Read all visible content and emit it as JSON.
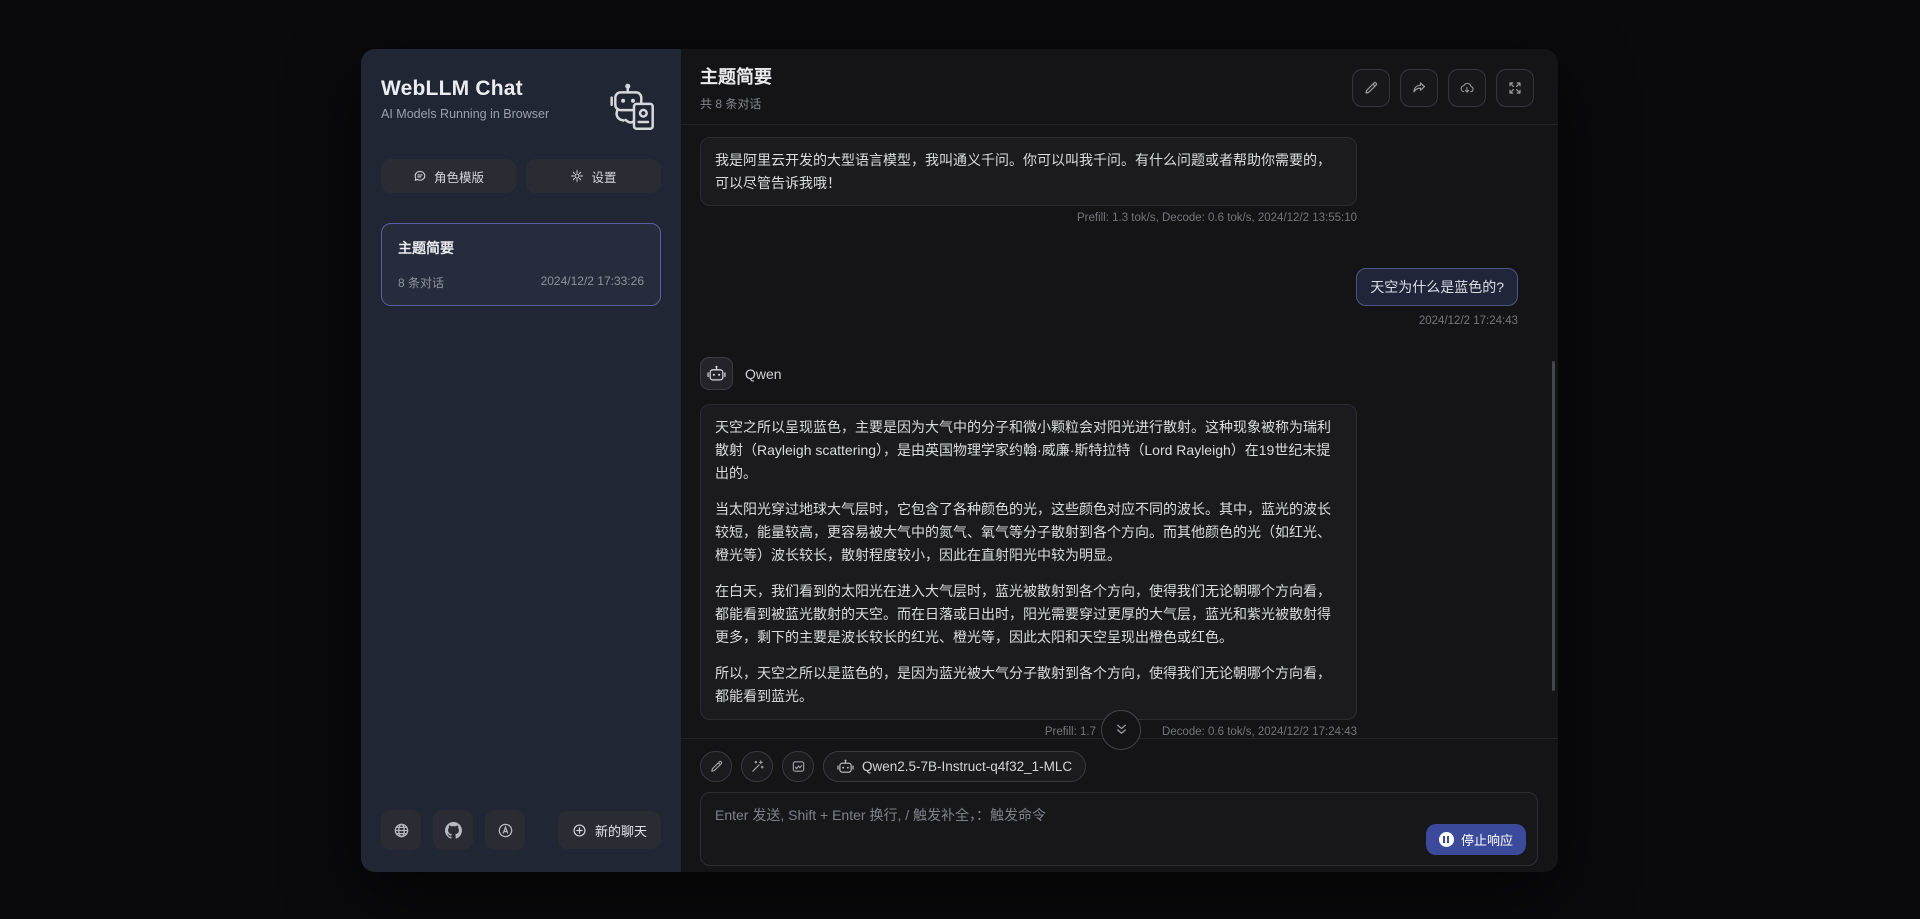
{
  "colors": {
    "accent_button": "#3b4a9a",
    "selected_chat_border": "#5a5fa0",
    "user_bubble_border": "#4d5680",
    "sidebar_bg": "#212634",
    "main_bg": "#141416"
  },
  "sidebar": {
    "title": "WebLLM Chat",
    "subtitle": "AI Models Running in Browser",
    "templates_button": "角色模版",
    "settings_button": "设置",
    "chat_item": {
      "title": "主题简要",
      "count": "8 条对话",
      "time": "2024/12/2 17:33:26"
    },
    "new_chat_button": "新的聊天"
  },
  "header": {
    "title": "主题简要",
    "subtitle": "共 8 条对话"
  },
  "chat": {
    "assistant_intro": {
      "text": "我是阿里云开发的大型语言模型，我叫通义千问。你可以叫我千问。有什么问题或者帮助你需要的，可以尽管告诉我哦！",
      "stats": "Prefill: 1.3 tok/s,  Decode: 0.6 tok/s,  2024/12/2 13:55:10"
    },
    "user_question": {
      "text": "天空为什么是蓝色的?",
      "time": "2024/12/2 17:24:43"
    },
    "assistant_answer": {
      "name": "Qwen",
      "paragraphs": [
        "天空之所以呈现蓝色，主要是因为大气中的分子和微小颗粒会对阳光进行散射。这种现象被称为瑞利散射（Rayleigh scattering），是由英国物理学家约翰·威廉·斯特拉特（Lord Rayleigh）在19世纪末提出的。",
        "当太阳光穿过地球大气层时，它包含了各种颜色的光，这些颜色对应不同的波长。其中，蓝光的波长较短，能量较高，更容易被大气中的氮气、氧气等分子散射到各个方向。而其他颜色的光（如红光、橙光等）波长较长，散射程度较小，因此在直射阳光中较为明显。",
        "在白天，我们看到的太阳光在进入大气层时，蓝光被散射到各个方向，使得我们无论朝哪个方向看，都能看到被蓝光散射的天空。而在日落或日出时，阳光需要穿过更厚的大气层，蓝光和紫光被散射得更多，剩下的主要是波长较长的红光、橙光等，因此太阳和天空呈现出橙色或红色。",
        "所以，天空之所以是蓝色的，是因为蓝光被大气分子散射到各个方向，使得我们无论朝哪个方向看，都能看到蓝光。"
      ],
      "stats_left": "Prefill: 1.7",
      "stats_right": "Decode: 0.6 tok/s,  2024/12/2 17:24:43"
    }
  },
  "composer": {
    "model": "Qwen2.5-7B-Instruct-q4f32_1-MLC",
    "placeholder": "Enter 发送, Shift + Enter 换行, / 触发补全，：触发命令",
    "stop_button": "停止响应"
  }
}
